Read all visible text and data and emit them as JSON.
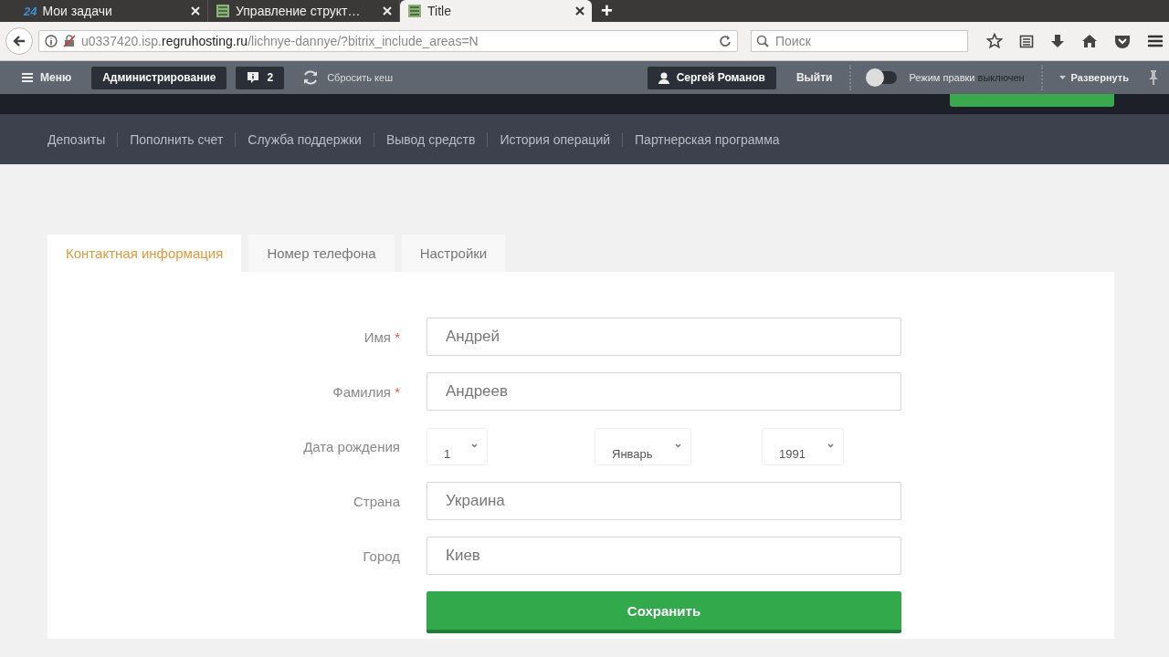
{
  "browser": {
    "tabs": [
      {
        "title": "Мои задачи",
        "favicon_text": "24",
        "selected": false
      },
      {
        "title": "Управление структ…",
        "selected": false
      },
      {
        "title": "Title",
        "selected": true
      }
    ],
    "new_tab": "+",
    "url": "u0337420.isp.**regruhosting.ru**/lichnye-dannye/?bitrix_include_areas=N",
    "search": {
      "placeholder": "Поиск"
    }
  },
  "admin_bar": {
    "menu": "Меню",
    "admin": "Администрирование",
    "notifications": "2",
    "clear_cache": "Сбросить кеш",
    "user": "Сергей Романов",
    "logout": "Выйти",
    "edit_mode": {
      "label": "Режим правки",
      "status": "выключен",
      "on": false
    },
    "expand": "Развернуть"
  },
  "nav": [
    "Депозиты",
    "Пополнить счет",
    "Служба поддержки",
    "Вывод средств",
    "История операций",
    "Партнерская программа"
  ],
  "tabs": [
    {
      "label": "Контактная информация",
      "selected": true
    },
    {
      "label": "Номер телефона",
      "selected": false
    },
    {
      "label": "Настройки",
      "selected": false
    }
  ],
  "form": {
    "fields": [
      {
        "kind": "text",
        "label": "Имя",
        "required_mark": "*",
        "value": "Андрей"
      },
      {
        "kind": "text",
        "label": "Фамилия",
        "required_mark": "*",
        "value": "Андреев"
      },
      {
        "kind": "date",
        "label": "Дата рождения",
        "day": "1",
        "month": "Январь",
        "year": "1991"
      },
      {
        "kind": "text",
        "label": "Страна",
        "value": "Украина"
      },
      {
        "kind": "text",
        "label": "Город",
        "value": "Киев"
      }
    ],
    "submit": "Сохранить"
  }
}
